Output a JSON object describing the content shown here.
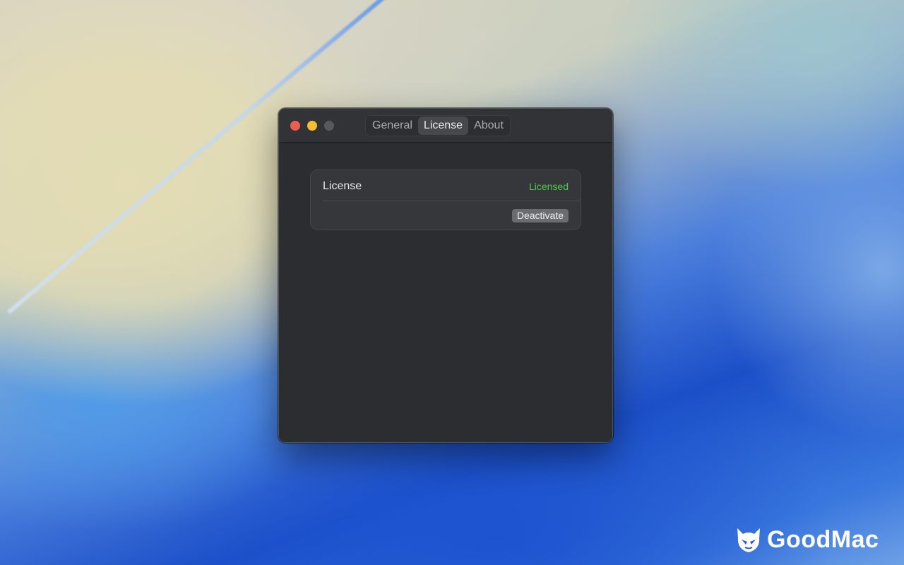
{
  "window": {
    "tabs": [
      {
        "label": "General",
        "active": false
      },
      {
        "label": "License",
        "active": true
      },
      {
        "label": "About",
        "active": false
      }
    ]
  },
  "license_card": {
    "title": "License",
    "status": "Licensed",
    "status_color": "#4fcb4f",
    "deactivate_label": "Deactivate"
  },
  "watermark": {
    "text": "GoodMac",
    "icon": "goodmac-logo-icon"
  },
  "colors": {
    "close": "#ee5d52",
    "minimize": "#f5bd2f",
    "zoom_disabled": "#58595c"
  }
}
